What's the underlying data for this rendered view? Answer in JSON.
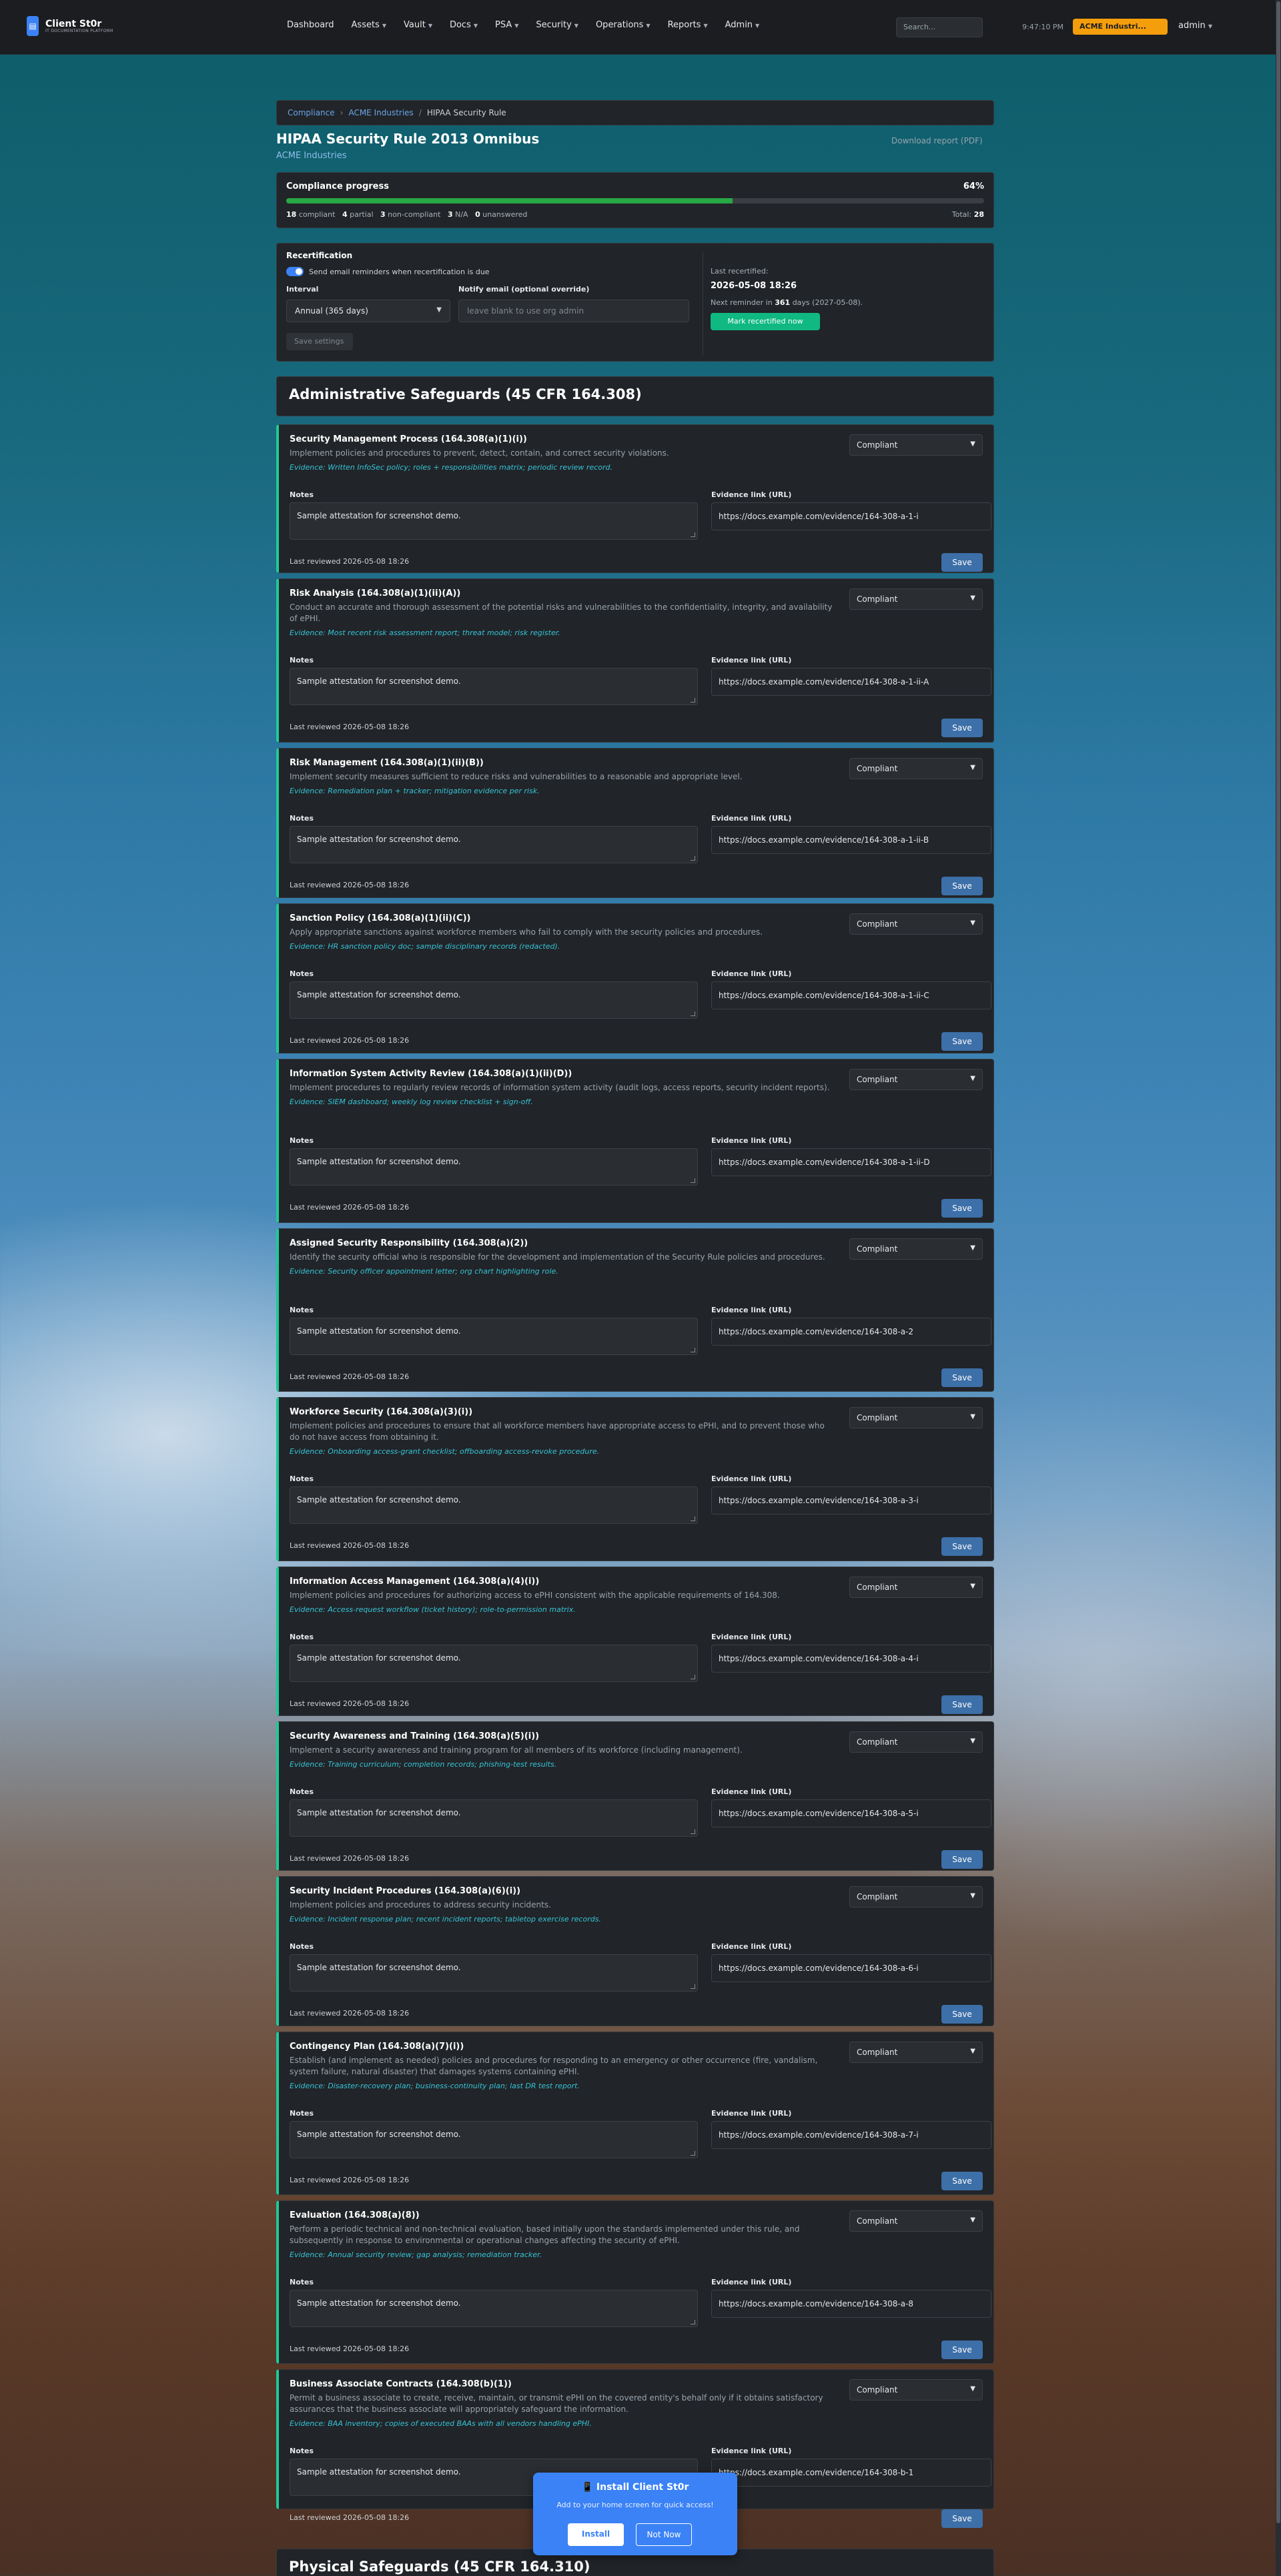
{
  "nav": {
    "brand_title": "Client St0r",
    "brand_subtitle": "IT DOCUMENTATION PLATFORM",
    "items": [
      {
        "label": "Dashboard",
        "dropdown": false
      },
      {
        "label": "Assets",
        "dropdown": true
      },
      {
        "label": "Vault",
        "dropdown": true
      },
      {
        "label": "Docs",
        "dropdown": true
      },
      {
        "label": "PSA",
        "dropdown": true
      },
      {
        "label": "Security",
        "dropdown": true
      },
      {
        "label": "Operations",
        "dropdown": true
      },
      {
        "label": "Reports",
        "dropdown": true
      },
      {
        "label": "Admin",
        "dropdown": true
      }
    ],
    "search_placeholder": "Search...",
    "time": "9:47:10 PM",
    "tenant": "ACME Industri...",
    "user": "admin"
  },
  "breadcrumb": {
    "items": [
      "Compliance",
      "ACME Industries"
    ],
    "current": "HIPAA Security Rule"
  },
  "page": {
    "title": "HIPAA Security Rule 2013 Omnibus",
    "subtitle": "ACME Industries",
    "download": "Download report (PDF)"
  },
  "progress": {
    "title": "Compliance progress",
    "percent_label": "64%",
    "percent": 64,
    "compliant": "18",
    "compliant_label": "compliant",
    "partial": "4",
    "partial_label": "partial",
    "noncompliant": "3",
    "noncompliant_label": "non-compliant",
    "na": "3",
    "na_label": "N/A",
    "unanswered": "0",
    "unanswered_label": "unanswered",
    "total_label": "Total:",
    "total": "28"
  },
  "recert": {
    "title": "Recertification",
    "toggle_label": "Send email reminders when recertification is due",
    "interval_label": "Interval",
    "interval_value": "Annual (365 days)",
    "email_label": "Notify email (optional override)",
    "email_placeholder": "leave blank to use org admin",
    "save_label": "Save settings",
    "last_label": "Last recertified:",
    "last_date": "2026-05-08 18:26",
    "next_prefix": "Next reminder in",
    "next_days": "361",
    "next_suffix": "days (2027-05-08).",
    "button": "Mark recertified now"
  },
  "section": {
    "title": "Administrative Safeguards (45 CFR 164.308)",
    "next_title": "Physical Safeguards (45 CFR 164.310)"
  },
  "labels": {
    "notes": "Notes",
    "evidence": "Evidence link (URL)",
    "save": "Save"
  },
  "controls": [
    {
      "title": "Security Management Process (164.308(a)(1)(i))",
      "desc": "Implement policies and procedures to prevent, detect, contain, and correct security violations.",
      "evidence": "Evidence: Written InfoSec policy; roles + responsibilities matrix; periodic review record.",
      "status": "Compliant",
      "notes": "Sample attestation for screenshot demo.",
      "link": "https://docs.example.com/evidence/164-308-a-1-i",
      "reviewed": "Last reviewed 2026-05-08 18:26"
    },
    {
      "title": "Risk Analysis (164.308(a)(1)(ii)(A))",
      "desc": "Conduct an accurate and thorough assessment of the potential risks and vulnerabilities to the confidentiality, integrity, and availability of ePHI.",
      "evidence": "Evidence: Most recent risk assessment report; threat model; risk register.",
      "status": "Compliant",
      "notes": "Sample attestation for screenshot demo.",
      "link": "https://docs.example.com/evidence/164-308-a-1-ii-A",
      "reviewed": "Last reviewed 2026-05-08 18:26"
    },
    {
      "title": "Risk Management (164.308(a)(1)(ii)(B))",
      "desc": "Implement security measures sufficient to reduce risks and vulnerabilities to a reasonable and appropriate level.",
      "evidence": "Evidence: Remediation plan + tracker; mitigation evidence per risk.",
      "status": "Compliant",
      "notes": "Sample attestation for screenshot demo.",
      "link": "https://docs.example.com/evidence/164-308-a-1-ii-B",
      "reviewed": "Last reviewed 2026-05-08 18:26"
    },
    {
      "title": "Sanction Policy (164.308(a)(1)(ii)(C))",
      "desc": "Apply appropriate sanctions against workforce members who fail to comply with the security policies and procedures.",
      "evidence": "Evidence: HR sanction policy doc; sample disciplinary records (redacted).",
      "status": "Compliant",
      "notes": "Sample attestation for screenshot demo.",
      "link": "https://docs.example.com/evidence/164-308-a-1-ii-C",
      "reviewed": "Last reviewed 2026-05-08 18:26"
    },
    {
      "title": "Information System Activity Review (164.308(a)(1)(ii)(D))",
      "desc": "Implement procedures to regularly review records of information system activity (audit logs, access reports, security incident reports).",
      "evidence": "Evidence: SIEM dashboard; weekly log review checklist + sign-off.",
      "status": "Compliant",
      "notes": "Sample attestation for screenshot demo.",
      "link": "https://docs.example.com/evidence/164-308-a-1-ii-D",
      "reviewed": "Last reviewed 2026-05-08 18:26"
    },
    {
      "title": "Assigned Security Responsibility (164.308(a)(2))",
      "desc": "Identify the security official who is responsible for the development and implementation of the Security Rule policies and procedures.",
      "evidence": "Evidence: Security officer appointment letter; org chart highlighting role.",
      "status": "Compliant",
      "notes": "Sample attestation for screenshot demo.",
      "link": "https://docs.example.com/evidence/164-308-a-2",
      "reviewed": "Last reviewed 2026-05-08 18:26"
    },
    {
      "title": "Workforce Security (164.308(a)(3)(i))",
      "desc": "Implement policies and procedures to ensure that all workforce members have appropriate access to ePHI, and to prevent those who do not have access from obtaining it.",
      "evidence": "Evidence: Onboarding access-grant checklist; offboarding access-revoke procedure.",
      "status": "Compliant",
      "notes": "Sample attestation for screenshot demo.",
      "link": "https://docs.example.com/evidence/164-308-a-3-i",
      "reviewed": "Last reviewed 2026-05-08 18:26"
    },
    {
      "title": "Information Access Management (164.308(a)(4)(i))",
      "desc": "Implement policies and procedures for authorizing access to ePHI consistent with the applicable requirements of 164.308.",
      "evidence": "Evidence: Access-request workflow (ticket history); role-to-permission matrix.",
      "status": "Compliant",
      "notes": "Sample attestation for screenshot demo.",
      "link": "https://docs.example.com/evidence/164-308-a-4-i",
      "reviewed": "Last reviewed 2026-05-08 18:26"
    },
    {
      "title": "Security Awareness and Training (164.308(a)(5)(i))",
      "desc": "Implement a security awareness and training program for all members of its workforce (including management).",
      "evidence": "Evidence: Training curriculum; completion records; phishing-test results.",
      "status": "Compliant",
      "notes": "Sample attestation for screenshot demo.",
      "link": "https://docs.example.com/evidence/164-308-a-5-i",
      "reviewed": "Last reviewed 2026-05-08 18:26"
    },
    {
      "title": "Security Incident Procedures (164.308(a)(6)(i))",
      "desc": "Implement policies and procedures to address security incidents.",
      "evidence": "Evidence: Incident response plan; recent incident reports; tabletop exercise records.",
      "status": "Compliant",
      "notes": "Sample attestation for screenshot demo.",
      "link": "https://docs.example.com/evidence/164-308-a-6-i",
      "reviewed": "Last reviewed 2026-05-08 18:26"
    },
    {
      "title": "Contingency Plan (164.308(a)(7)(i))",
      "desc": "Establish (and implement as needed) policies and procedures for responding to an emergency or other occurrence (fire, vandalism, system failure, natural disaster) that damages systems containing ePHI.",
      "evidence": "Evidence: Disaster-recovery plan; business-continuity plan; last DR test report.",
      "status": "Compliant",
      "notes": "Sample attestation for screenshot demo.",
      "link": "https://docs.example.com/evidence/164-308-a-7-i",
      "reviewed": "Last reviewed 2026-05-08 18:26"
    },
    {
      "title": "Evaluation (164.308(a)(8))",
      "desc": "Perform a periodic technical and non-technical evaluation, based initially upon the standards implemented under this rule, and subsequently in response to environmental or operational changes affecting the security of ePHI.",
      "evidence": "Evidence: Annual security review; gap analysis; remediation tracker.",
      "status": "Compliant",
      "notes": "Sample attestation for screenshot demo.",
      "link": "https://docs.example.com/evidence/164-308-a-8",
      "reviewed": "Last reviewed 2026-05-08 18:26"
    },
    {
      "title": "Business Associate Contracts (164.308(b)(1))",
      "desc": "Permit a business associate to create, receive, maintain, or transmit ePHI on the covered entity's behalf only if it obtains satisfactory assurances that the business associate will appropriately safeguard the information.",
      "evidence": "Evidence: BAA inventory; copies of executed BAAs with all vendors handling ePHI.",
      "status": "Compliant",
      "notes": "Sample attestation for screenshot demo.",
      "link": "https://docs.example.com/evidence/164-308-b-1",
      "reviewed": "Last reviewed 2026-05-08 18:26"
    }
  ],
  "install": {
    "title": "Install Client St0r",
    "text": "Add to your home screen for quick access!",
    "yes": "Install",
    "no": "Not Now"
  }
}
